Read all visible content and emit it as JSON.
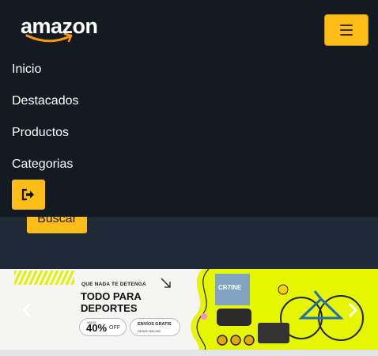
{
  "logo": {
    "text": "amazon"
  },
  "header": {
    "menu_toggle_icon": "hamburger-menu-icon"
  },
  "nav": {
    "items": [
      {
        "label": "Inicio"
      },
      {
        "label": "Destacados"
      },
      {
        "label": "Productos"
      },
      {
        "label": "Categorias"
      }
    ],
    "logout_icon": "sign-out-icon"
  },
  "search": {
    "button_label": "Buscar"
  },
  "banner": {
    "tagline": "QUE NADA TE DETENGA",
    "title": "TODO PARA DEPORTES",
    "discount_prefix": "HASTA",
    "discount_value": "40%",
    "discount_suffix": "OFF",
    "shipping_line1": "ENVÍOS GRATIS",
    "shipping_line2": "DESDE $90.000",
    "product_label": "CR7INE"
  },
  "carousel": {
    "prev_icon": "chevron-left-icon",
    "next_icon": "chevron-right-icon"
  },
  "colors": {
    "accent": "#febd17",
    "navbar": "#131a22",
    "page": "#232f3e",
    "banner_yellow": "#e6f500"
  }
}
